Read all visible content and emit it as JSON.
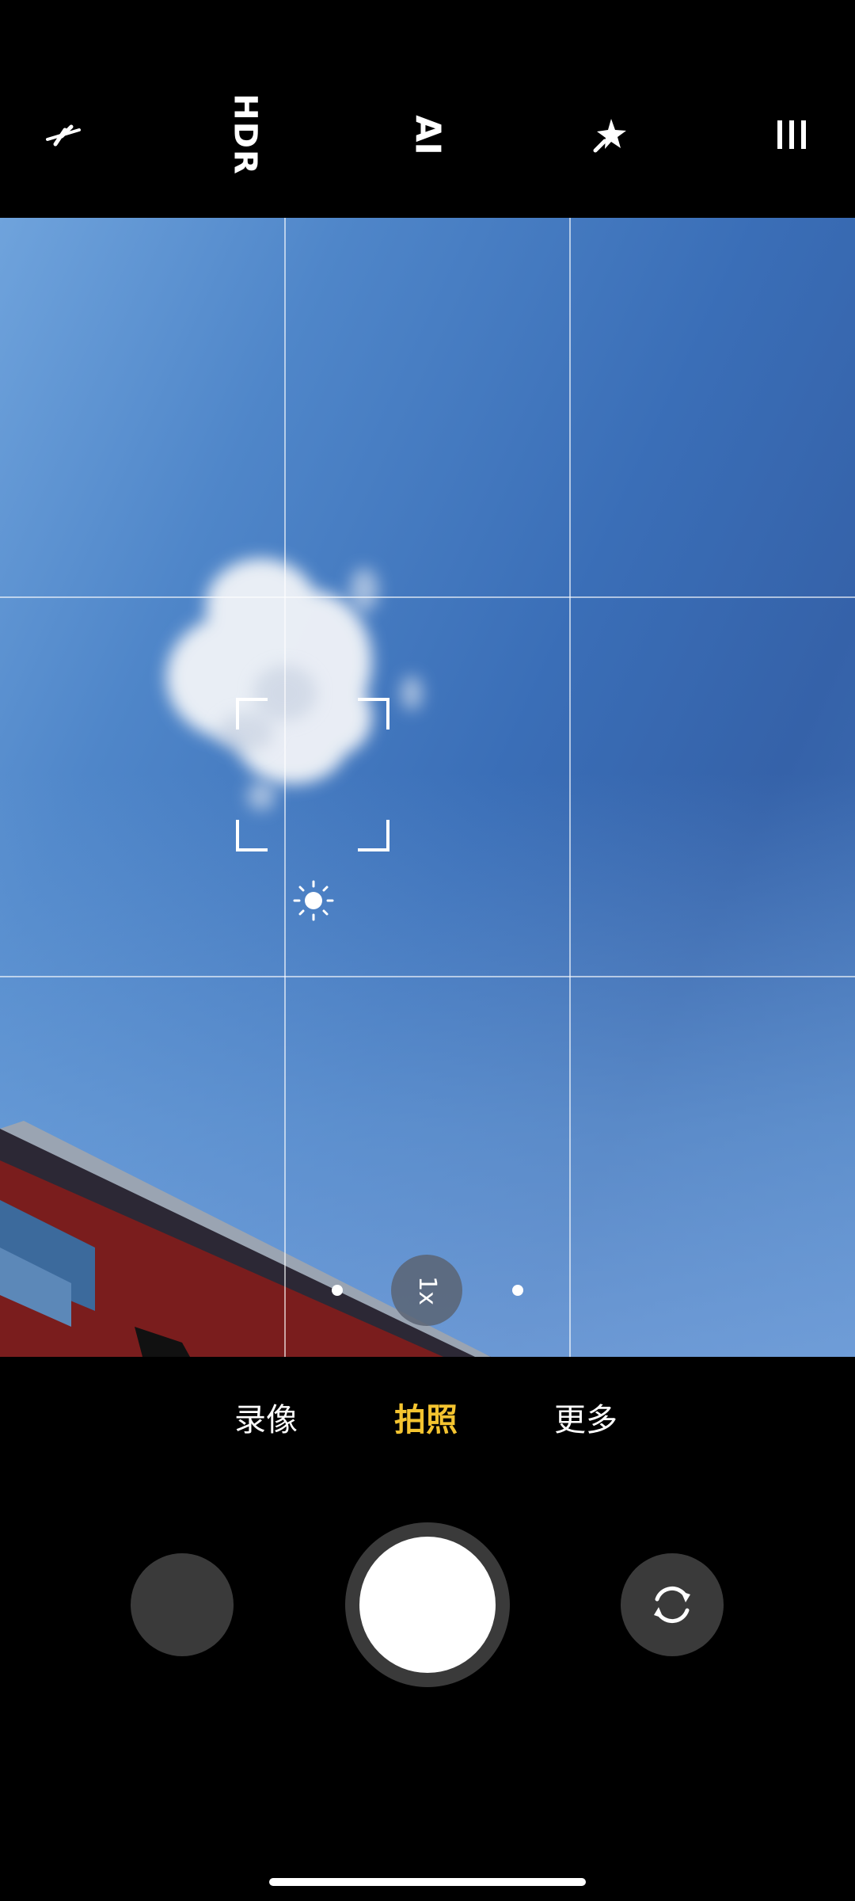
{
  "toolbar": {
    "flash_icon": "flash-off-icon",
    "hdr_label": "HDR",
    "ai_label": "AI",
    "beauty_icon": "magic-star-icon",
    "menu_icon": "menu-lines-icon"
  },
  "viewfinder": {
    "grid": "3x3",
    "zoom_label": "1x"
  },
  "modes": {
    "items": [
      {
        "label": "录像",
        "active": false
      },
      {
        "label": "拍照",
        "active": true
      },
      {
        "label": "更多",
        "active": false
      }
    ]
  },
  "colors": {
    "active_mode": "#f4c430",
    "background": "#000000",
    "control_gray": "#3a3a3a"
  }
}
